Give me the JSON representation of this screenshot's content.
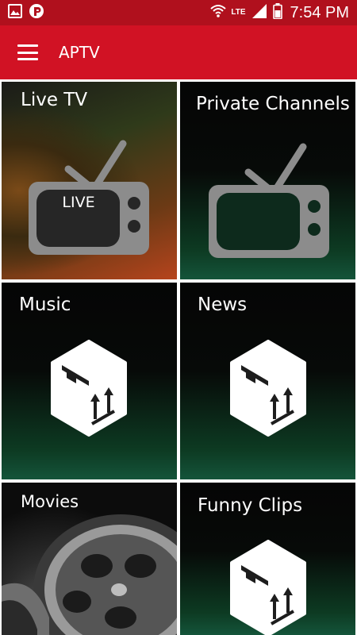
{
  "status_bar": {
    "time": "7:54 PM",
    "network": "LTE",
    "icons": [
      "gallery-icon",
      "p-app-icon",
      "wifi-icon",
      "signal-icon",
      "battery-icon"
    ]
  },
  "app_bar": {
    "title": "APTV",
    "menu_icon": "hamburger-menu-icon"
  },
  "tiles": [
    {
      "label": "Live TV",
      "icon": "tv-icon",
      "badge": "LIVE"
    },
    {
      "label": "Private Channels",
      "icon": "tv-icon"
    },
    {
      "label": "Music",
      "icon": "package-box-icon"
    },
    {
      "label": "News",
      "icon": "package-box-icon"
    },
    {
      "label": "Movies",
      "icon": "film-reel-icon"
    },
    {
      "label": "Funny Clips",
      "icon": "package-box-icon"
    }
  ],
  "colors": {
    "status_bar": "#b0101d",
    "app_bar": "#d11224",
    "icon_gray": "#8c8c8c"
  }
}
